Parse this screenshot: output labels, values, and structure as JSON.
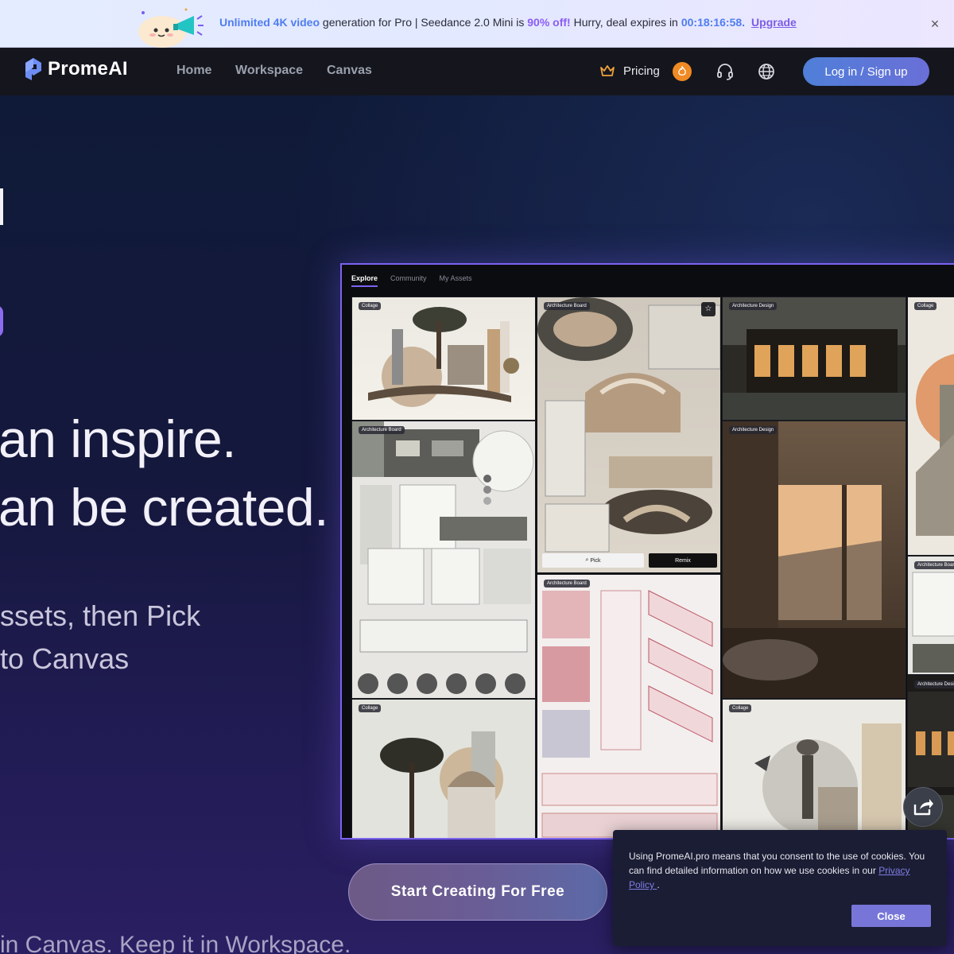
{
  "promo": {
    "part1": "Unlimited 4K video",
    "part2": " generation for Pro | Seedance 2.0 Mini is ",
    "part3": "90% off!",
    "part4": " Hurry, deal expires in",
    "timer": "00:18:16:58.",
    "upgrade": "Upgrade",
    "close": "×"
  },
  "nav": {
    "logo": "PromeAI",
    "links": [
      "Home",
      "Workspace",
      "Canvas"
    ],
    "pricing": "Pricing",
    "login": "Log in / Sign up"
  },
  "hero": {
    "line1": "an inspire.",
    "line2": "an be created.",
    "sub1": "ssets, then Pick",
    "sub2": "to Canvas",
    "cta": "Start Creating For Free",
    "tagline": "in Canvas. Keep it in Workspace."
  },
  "preview": {
    "tabs": [
      "Explore",
      "Community",
      "My Assets"
    ],
    "tags": {
      "collage": "Collage",
      "architecture_board": "Architecture Board",
      "architecture_design": "Architecture Design"
    },
    "pick": "Pick",
    "remix": "Remix"
  },
  "cookie": {
    "text": "Using PromeAI.pro means that you consent to the use of cookies. You can find detailed information on how we use cookies in our ",
    "link": "Privacy Policy ",
    "end": ".",
    "close": "Close"
  },
  "colors": {
    "accent": "#7c62f2",
    "login_button": "#5b78d8",
    "cookie_button": "#7776d8"
  }
}
